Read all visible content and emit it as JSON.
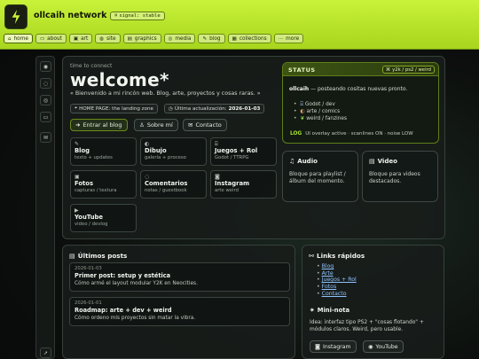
{
  "header": {
    "title": "ollcaih network",
    "signal": "signal: stable",
    "logo_icon": "lightning-bolt-icon",
    "accent": "#b5df27"
  },
  "nav": [
    {
      "label": "home",
      "icon": "home-icon",
      "active": true
    },
    {
      "label": "about",
      "icon": "id-card-icon"
    },
    {
      "label": "art",
      "icon": "image-icon"
    },
    {
      "label": "site",
      "icon": "globe-icon"
    },
    {
      "label": "graphics",
      "icon": "picture-icon"
    },
    {
      "label": "media",
      "icon": "disc-icon"
    },
    {
      "label": "blog",
      "icon": "pencil-icon"
    },
    {
      "label": "collections",
      "icon": "box-icon"
    },
    {
      "label": "more",
      "icon": "dots-icon"
    }
  ],
  "sidebar": [
    "rss-icon",
    "chat-icon",
    "target-icon",
    "message-icon",
    "mail-icon",
    "rocket-icon"
  ],
  "hero": {
    "kicker": "time to connect",
    "title": "welcome*",
    "subtitle": "« Bienvenido a mi rincón web. Blog, arte, proyectos y cosas raras. »",
    "homepage_chip": "HOME PAGE: the landing zone",
    "update_prefix": "Última actualización:",
    "update_date": "2026-01-03",
    "buttons": [
      "Entrar al blog",
      "Sobre mí",
      "Contacto"
    ]
  },
  "cards": [
    {
      "title": "Blog",
      "sub": "texto + updates",
      "icon": "pencil-icon"
    },
    {
      "title": "Dibujo",
      "sub": "galería + proceso",
      "icon": "palette-icon"
    },
    {
      "title": "Juegos + Rol",
      "sub": "Godot / TTRPG",
      "icon": "gamepad-icon"
    },
    {
      "title": "Fotos",
      "sub": "capturas / textura",
      "icon": "photo-icon"
    },
    {
      "title": "Comentarios",
      "sub": "notas / guestbook",
      "icon": "comment-icon"
    },
    {
      "title": "Instagram",
      "sub": "arte weird",
      "icon": "camera-icon"
    },
    {
      "title": "YouTube",
      "sub": "video / devlog",
      "icon": "play-icon"
    }
  ],
  "status": {
    "label": "STATUS",
    "tag": "y2k / ps2 / weird",
    "user": "ollcaih",
    "message": "— posteando cositas nuevas pronto.",
    "items": [
      "Godot / dev",
      "arte / comics",
      "weird / fanzines"
    ],
    "item_icons": [
      "gamepad-icon",
      "palette-icon",
      "leaf-icon"
    ],
    "log_tag": "LOG",
    "log_text": "UI overlay active · scanlines ON · noise LOW"
  },
  "audio": {
    "title": "Audio",
    "body": "Bloque para playlist / álbum del momento."
  },
  "video": {
    "title": "Video",
    "body": "Bloque para videos destacados."
  },
  "posts": {
    "title": "Últimos posts",
    "items": [
      {
        "date": "2026-01-03",
        "title": "Primer post: setup y estética",
        "excerpt": "Cómo armé el layout modular Y2K en Neocities."
      },
      {
        "date": "2026-01-01",
        "title": "Roadmap: arte + dev + weird",
        "excerpt": "Cómo ordeno mis proyectos sin matar la vibra."
      }
    ]
  },
  "links": {
    "title": "Links rápidos",
    "items": [
      "Blog",
      "Arte",
      "Juegos + Rol",
      "Fotos",
      "Contacto"
    ]
  },
  "mini_note": {
    "title": "Mini-nota",
    "body": "Idea: interfaz tipo PS2 + \"cosas flotando\" + módulos claros. Weird, pero usable.",
    "buttons": [
      "Instagram",
      "YouTube"
    ]
  }
}
